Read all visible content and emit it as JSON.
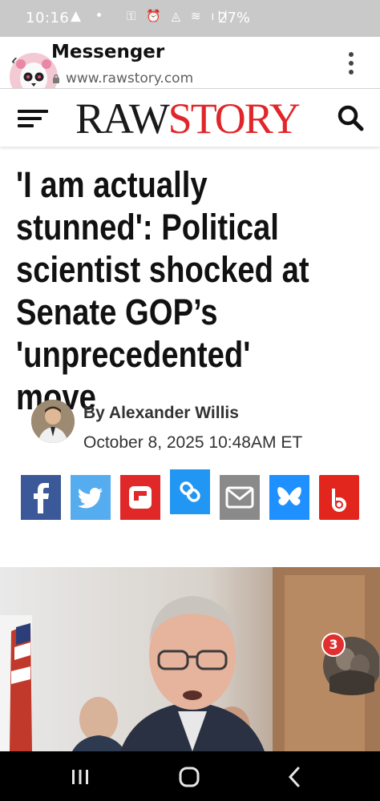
{
  "status_bar": {
    "time": "10:16",
    "battery": "27%"
  },
  "messenger": {
    "title": "Messenger",
    "url": "www.rawstory.com"
  },
  "site": {
    "logo_part1": "RAW",
    "logo_part2": "STORY"
  },
  "article": {
    "headline": "'I am actually stunned': Political scientist shocked at Senate GOP’s 'unprecedented' move",
    "byline": "By Alexander Willis",
    "date": "October 8, 2025 10:48AM ET"
  },
  "share_buttons": [
    {
      "name": "facebook",
      "color": "#3b5998"
    },
    {
      "name": "twitter",
      "color": "#55acee"
    },
    {
      "name": "flipboard",
      "color": "#e12828"
    },
    {
      "name": "copy-link",
      "color": "#2196f3"
    },
    {
      "name": "email",
      "color": "#8a8a8a"
    },
    {
      "name": "bluesky",
      "color": "#1e90ff"
    },
    {
      "name": "bluesky-alt",
      "color": "#e2261d"
    }
  ],
  "chat_head": {
    "badge_count": "3"
  },
  "colors": {
    "accent_red": "#e0262a",
    "text_dark": "#111111",
    "status_bar": "#c9c9c9",
    "nav_bar": "#000000"
  }
}
